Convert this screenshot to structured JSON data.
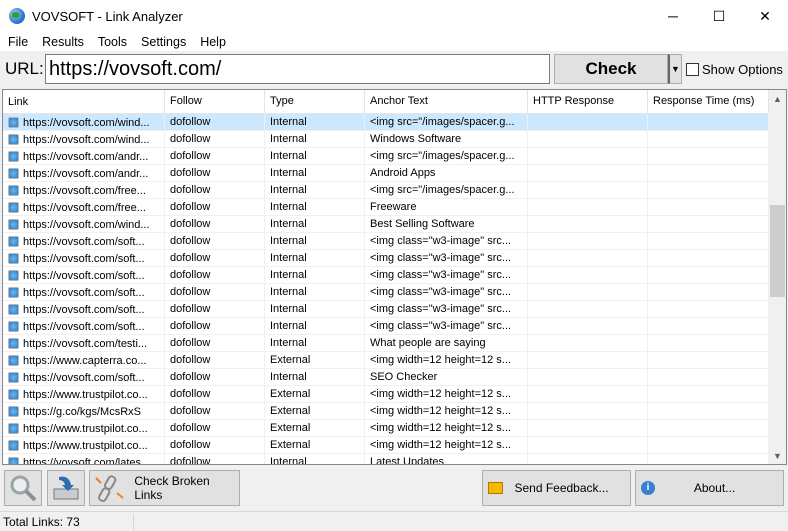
{
  "window": {
    "title": "VOVSOFT - Link Analyzer",
    "minimize": "─",
    "maximize": "☐",
    "close": "✕"
  },
  "menu": [
    "File",
    "Results",
    "Tools",
    "Settings",
    "Help"
  ],
  "url": {
    "label": "URL:",
    "value": "https://vovsoft.com/"
  },
  "check_label": "Check",
  "dropdown_glyph": "▼",
  "show_options_label": "Show Options",
  "columns": [
    "Link",
    "Follow",
    "Type",
    "Anchor Text",
    "HTTP Response",
    "Response Time (ms)"
  ],
  "rows": [
    [
      "https://vovsoft.com/wind...",
      "dofollow",
      "Internal",
      "<img src=\"/images/spacer.g...",
      "",
      ""
    ],
    [
      "https://vovsoft.com/wind...",
      "dofollow",
      "Internal",
      "Windows Software",
      "",
      ""
    ],
    [
      "https://vovsoft.com/andr...",
      "dofollow",
      "Internal",
      "<img src=\"/images/spacer.g...",
      "",
      ""
    ],
    [
      "https://vovsoft.com/andr...",
      "dofollow",
      "Internal",
      "Android Apps",
      "",
      ""
    ],
    [
      "https://vovsoft.com/free...",
      "dofollow",
      "Internal",
      "<img src=\"/images/spacer.g...",
      "",
      ""
    ],
    [
      "https://vovsoft.com/free...",
      "dofollow",
      "Internal",
      "Freeware",
      "",
      ""
    ],
    [
      "https://vovsoft.com/wind...",
      "dofollow",
      "Internal",
      "Best Selling Software",
      "",
      ""
    ],
    [
      "https://vovsoft.com/soft...",
      "dofollow",
      "Internal",
      "<img class=\"w3-image\" src...",
      "",
      ""
    ],
    [
      "https://vovsoft.com/soft...",
      "dofollow",
      "Internal",
      "<img class=\"w3-image\" src...",
      "",
      ""
    ],
    [
      "https://vovsoft.com/soft...",
      "dofollow",
      "Internal",
      "<img class=\"w3-image\" src...",
      "",
      ""
    ],
    [
      "https://vovsoft.com/soft...",
      "dofollow",
      "Internal",
      "<img class=\"w3-image\" src...",
      "",
      ""
    ],
    [
      "https://vovsoft.com/soft...",
      "dofollow",
      "Internal",
      "<img class=\"w3-image\" src...",
      "",
      ""
    ],
    [
      "https://vovsoft.com/soft...",
      "dofollow",
      "Internal",
      "<img class=\"w3-image\" src...",
      "",
      ""
    ],
    [
      "https://vovsoft.com/testi...",
      "dofollow",
      "Internal",
      "What people are saying",
      "",
      ""
    ],
    [
      "https://www.capterra.co...",
      "dofollow",
      "External",
      "<img width=12 height=12 s...",
      "",
      ""
    ],
    [
      "https://vovsoft.com/soft...",
      "dofollow",
      "Internal",
      "SEO Checker",
      "",
      ""
    ],
    [
      "https://www.trustpilot.co...",
      "dofollow",
      "External",
      "<img width=12 height=12 s...",
      "",
      ""
    ],
    [
      "https://g.co/kgs/McsRxS",
      "dofollow",
      "External",
      "<img width=12 height=12 s...",
      "",
      ""
    ],
    [
      "https://www.trustpilot.co...",
      "dofollow",
      "External",
      "<img width=12 height=12 s...",
      "",
      ""
    ],
    [
      "https://www.trustpilot.co...",
      "dofollow",
      "External",
      "<img width=12 height=12 s...",
      "",
      ""
    ],
    [
      "https://vovsoft.com/lates...",
      "dofollow",
      "Internal",
      "Latest Updates",
      "",
      ""
    ]
  ],
  "toolbar": {
    "check_broken": "Check Broken Links",
    "feedback": "Send Feedback...",
    "about": "About..."
  },
  "status": {
    "total": "Total Links: 73"
  }
}
